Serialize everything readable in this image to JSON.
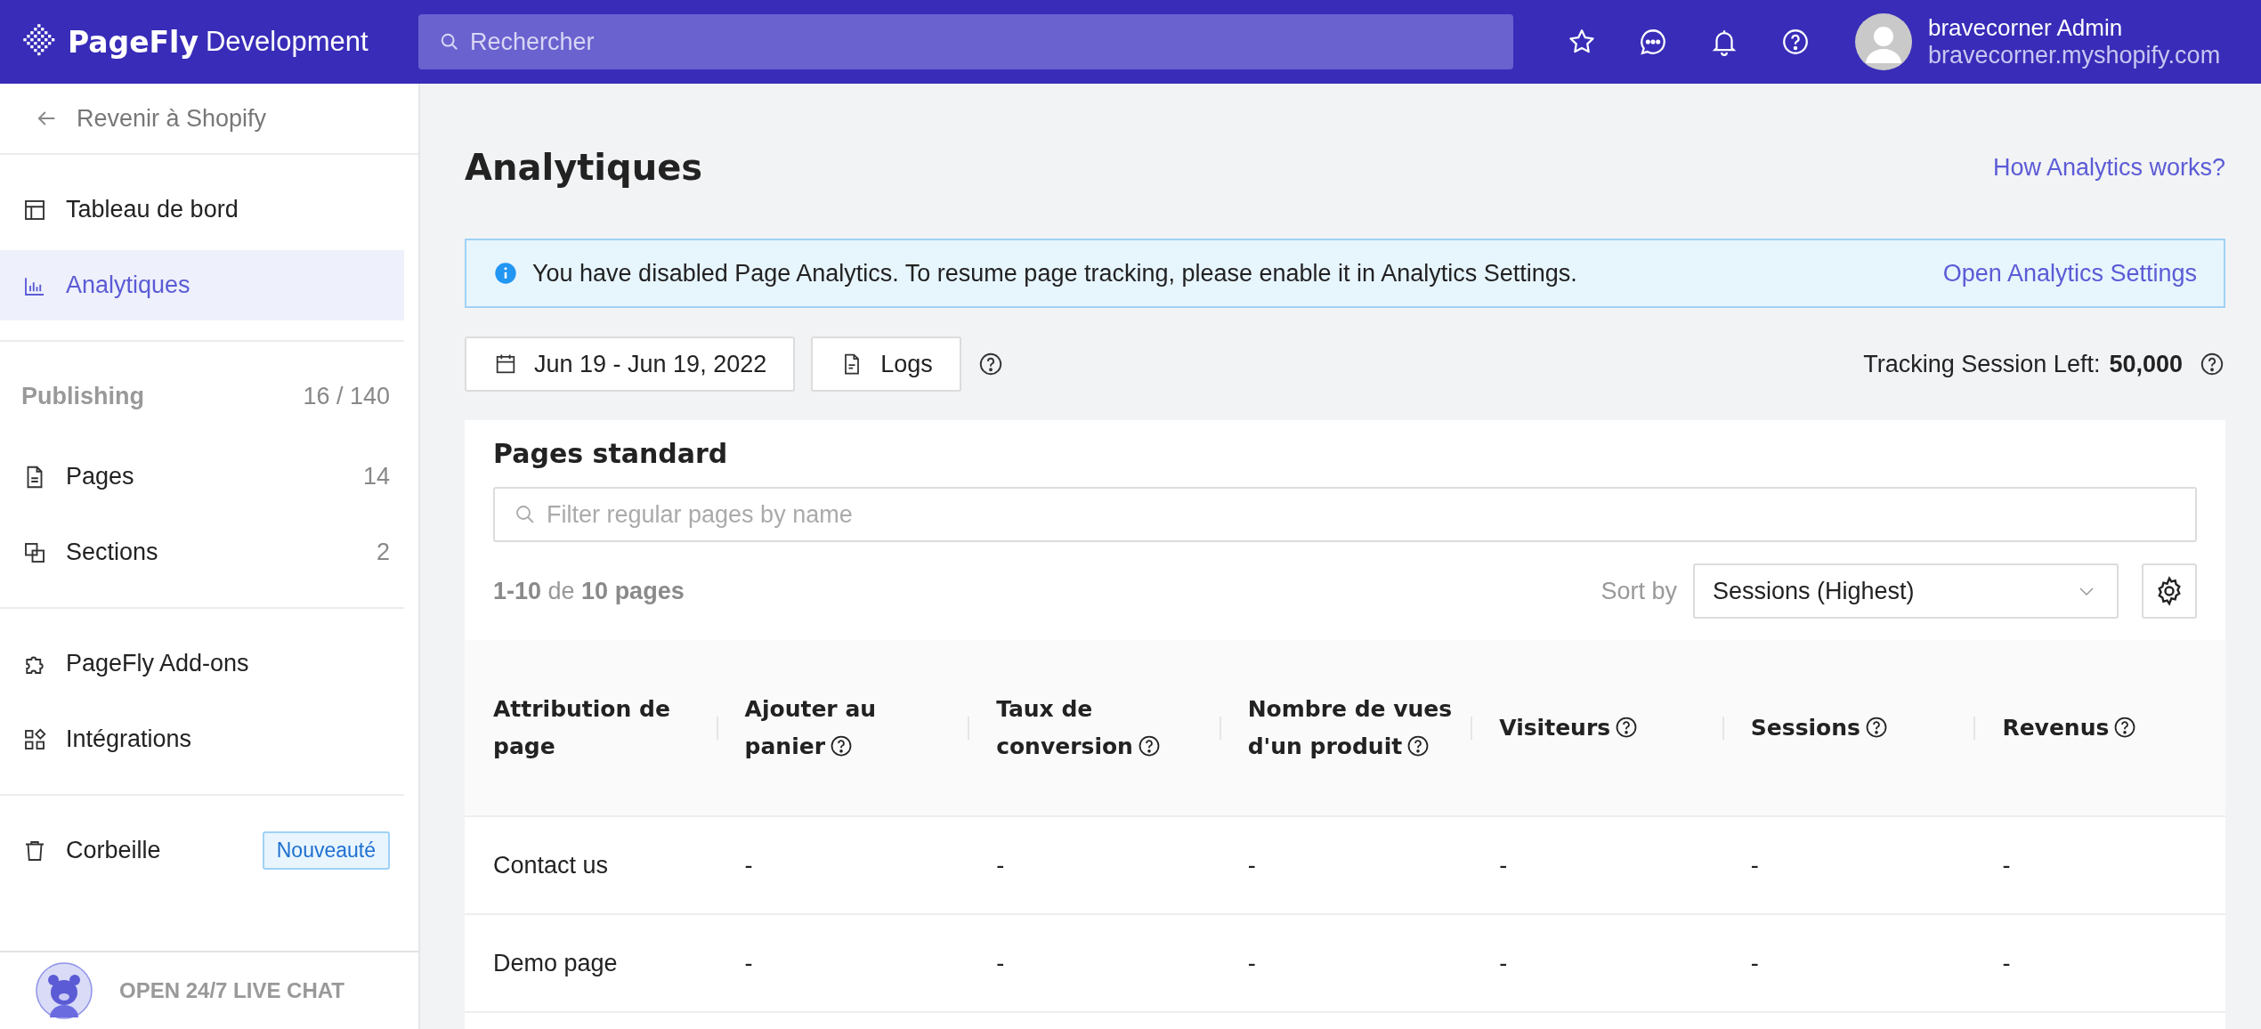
{
  "header": {
    "brand": "PageFly",
    "brand_suffix": "Development",
    "search": {
      "placeholder": "Rechercher"
    },
    "user": {
      "name": "bravecorner Admin",
      "store": "bravecorner.myshopify.com"
    }
  },
  "sidebar": {
    "back": "Revenir à Shopify",
    "groups": [
      {
        "items": [
          {
            "kind": "dashboard",
            "label": "Tableau de bord",
            "selected": false
          },
          {
            "kind": "chart",
            "label": "Analytiques",
            "selected": true
          }
        ]
      },
      {
        "heading": "Publishing",
        "heading_count": "16 / 140",
        "items": [
          {
            "kind": "page",
            "label": "Pages",
            "count": "14",
            "selected": false
          },
          {
            "kind": "sections",
            "label": "Sections",
            "count": "2",
            "selected": false
          }
        ]
      },
      {
        "items": [
          {
            "kind": "puzzle",
            "label": "PageFly Add-ons",
            "selected": false
          },
          {
            "kind": "apps",
            "label": "Intégrations",
            "selected": false
          }
        ]
      },
      {
        "items": [
          {
            "kind": "trash",
            "label": "Corbeille",
            "badge": "Nouveauté",
            "selected": false
          }
        ]
      }
    ],
    "chat": "OPEN 24/7 LIVE CHAT"
  },
  "page": {
    "title": "Analytiques",
    "help_link": "How Analytics works?",
    "banner": {
      "message": "You have disabled Page Analytics. To resume page tracking, please enable it in Analytics Settings.",
      "action": "Open Analytics Settings"
    },
    "date_range": "Jun 19 - Jun 19, 2022",
    "logs": "Logs",
    "tracking_label": "Tracking Session Left:",
    "tracking_value": "50,000",
    "card": {
      "title": "Pages standard",
      "filter": {
        "placeholder": "Filter regular pages by name"
      },
      "count": "**1-10** de **10 pages**",
      "sort_label": "Sort by",
      "sort_value": "Sessions (Highest)",
      "table": {
        "columns": [
          {
            "label": "Attribution de page",
            "help": false
          },
          {
            "label": "Ajouter au panier",
            "help": true
          },
          {
            "label": "Taux de conversion",
            "help": true
          },
          {
            "label": "Nombre de vues d'un produit",
            "help": true
          },
          {
            "label": "Visiteurs",
            "help": true
          },
          {
            "label": "Sessions",
            "help": true
          },
          {
            "label": "Revenus",
            "help": true
          }
        ],
        "rows": [
          [
            "Contact us",
            "-",
            "-",
            "-",
            "-",
            "-",
            "-"
          ],
          [
            "Demo page",
            "-",
            "-",
            "-",
            "-",
            "-",
            "-"
          ]
        ]
      }
    }
  }
}
